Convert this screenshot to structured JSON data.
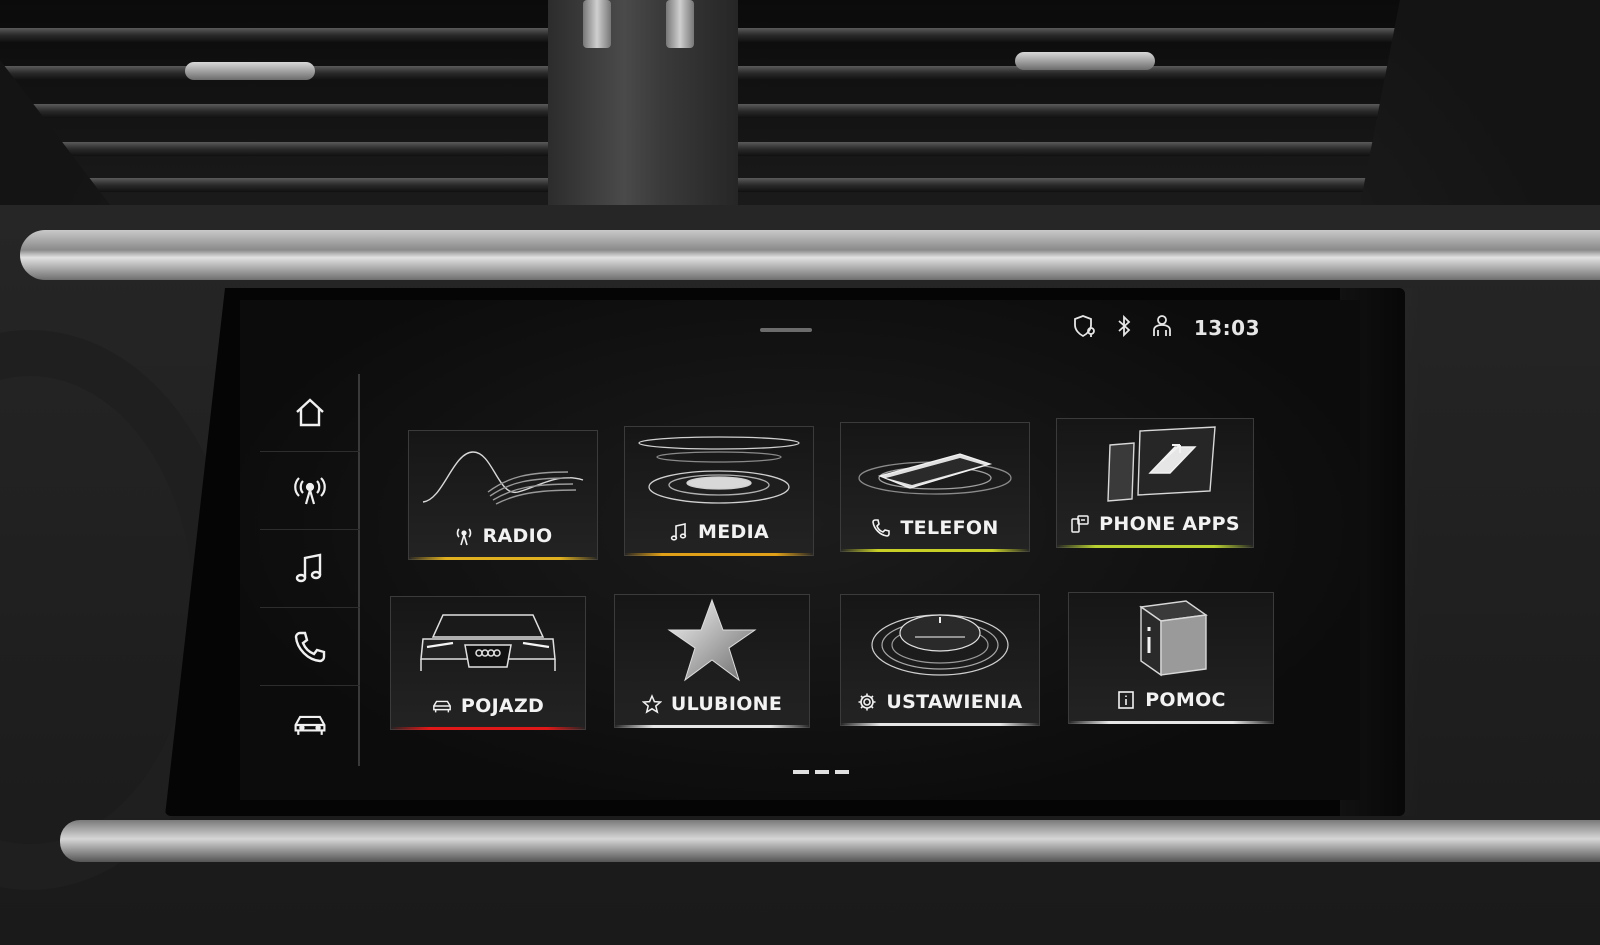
{
  "status": {
    "time": "13:03",
    "icons": [
      "location-privacy-icon",
      "bluetooth-icon",
      "driver-profile-icon"
    ]
  },
  "sidebar": {
    "items": [
      {
        "icon": "home-icon"
      },
      {
        "icon": "radio-icon"
      },
      {
        "icon": "music-note-icon"
      },
      {
        "icon": "phone-icon"
      },
      {
        "icon": "car-icon"
      }
    ]
  },
  "tiles": [
    {
      "label": "RADIO",
      "icon": "radio-icon",
      "accent": "#e0b020"
    },
    {
      "label": "MEDIA",
      "icon": "music-note-icon",
      "accent": "#e0a018"
    },
    {
      "label": "TELEFON",
      "icon": "phone-icon",
      "accent": "#c8d028"
    },
    {
      "label": "PHONE APPS",
      "icon": "phone-apps-icon",
      "accent": "#b8d030"
    },
    {
      "label": "POJAZD",
      "icon": "car-icon",
      "accent": "#e01818"
    },
    {
      "label": "ULUBIONE",
      "icon": "star-icon",
      "accent": "#e6e6e6"
    },
    {
      "label": "USTAWIENIA",
      "icon": "gear-icon",
      "accent": "#e6e6e6"
    },
    {
      "label": "POMOC",
      "icon": "info-icon",
      "accent": "#e6e6e6"
    }
  ]
}
